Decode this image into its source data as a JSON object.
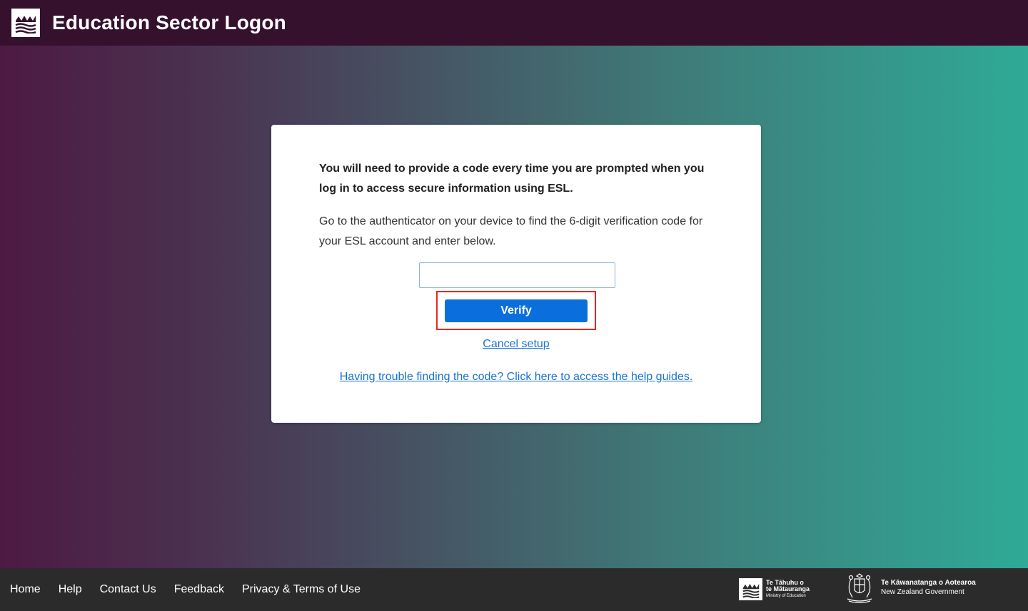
{
  "header": {
    "title": "Education Sector Logon",
    "logo_icon": "mountains-waves-logo-icon"
  },
  "card": {
    "intro_bold": "You will need to provide a code every time you are prompted when you log in to access secure information using ESL.",
    "instructions": "Go to the authenticator on your device to find the 6-digit verification code for your ESL account and enter below.",
    "code_input": {
      "value": "",
      "placeholder": ""
    },
    "verify_label": "Verify",
    "cancel_label": "Cancel setup",
    "help_label": "Having trouble finding the code? Click here to access the help guides."
  },
  "footer": {
    "links": [
      "Home",
      "Help",
      "Contact Us",
      "Feedback",
      "Privacy & Terms of Use"
    ],
    "moe_logo": {
      "line1": "Te Tāhuhu o",
      "line2": "te Mātauranga",
      "line3": "Ministry of Education"
    },
    "nzgov_logo": {
      "line1": "Te Kāwanatanga o Aotearoa",
      "line2": "New Zealand Government"
    }
  },
  "colors": {
    "header_bg": "#35112d",
    "footer_bg": "#2b2b2b",
    "verify_button": "#0a6fdc",
    "link": "#1a73d1",
    "highlight": "#e8281e"
  }
}
